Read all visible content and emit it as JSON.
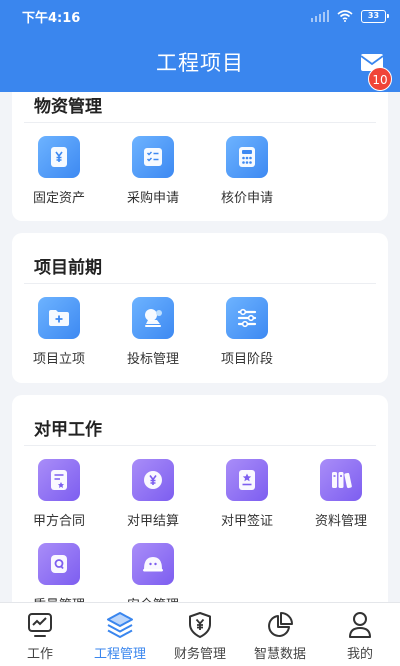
{
  "status_bar": {
    "time": "下午4:16",
    "battery": "33"
  },
  "header": {
    "title": "工程项目",
    "mail_badge": "10"
  },
  "sections": [
    {
      "title": "物资管理",
      "items": [
        {
          "label": "固定资产",
          "icon": "yen-doc-icon"
        },
        {
          "label": "采购申请",
          "icon": "checklist-icon"
        },
        {
          "label": "核价申请",
          "icon": "calculator-icon"
        }
      ]
    },
    {
      "title": "项目前期",
      "items": [
        {
          "label": "项目立项",
          "icon": "folder-plus-icon"
        },
        {
          "label": "投标管理",
          "icon": "stamp-icon"
        },
        {
          "label": "项目阶段",
          "icon": "sliders-icon"
        }
      ]
    },
    {
      "title": "对甲工作",
      "items": [
        {
          "label": "甲方合同",
          "icon": "contract-icon"
        },
        {
          "label": "对甲结算",
          "icon": "yen-circle-icon"
        },
        {
          "label": "对甲签证",
          "icon": "star-doc-icon"
        },
        {
          "label": "资料管理",
          "icon": "books-icon"
        },
        {
          "label": "质量管理",
          "icon": "quality-icon"
        },
        {
          "label": "安全管理",
          "icon": "helmet-icon"
        }
      ]
    }
  ],
  "tabbar": [
    {
      "label": "工作",
      "icon": "monitor-icon",
      "active": false
    },
    {
      "label": "工程管理",
      "icon": "layers-icon",
      "active": true
    },
    {
      "label": "财务管理",
      "icon": "yen-shield-icon",
      "active": false
    },
    {
      "label": "智慧数据",
      "icon": "pie-chart-icon",
      "active": false
    },
    {
      "label": "我的",
      "icon": "user-icon",
      "active": false
    }
  ],
  "colors": {
    "primary": "#3a86ee",
    "badge": "#f04438",
    "icon_blue": "#4a93f5",
    "icon_purple": "#8a6cf2"
  }
}
